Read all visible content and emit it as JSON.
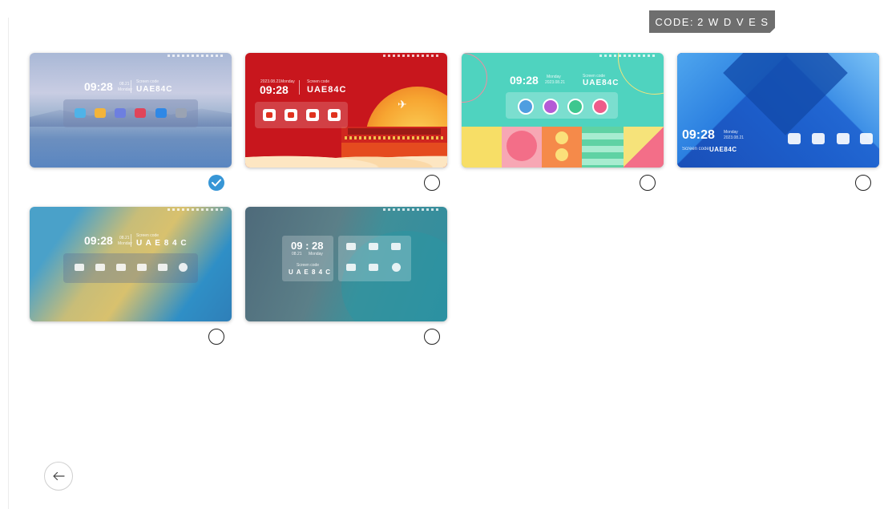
{
  "header": {
    "code_prefix": "CODE:",
    "code_value": "2 W D V E S"
  },
  "themes": [
    {
      "name": "misty-lake",
      "time": "09:28",
      "day": "Monday",
      "date": "08.21",
      "code_label": "Screen code",
      "screen_code": "UAE84C",
      "selected": true
    },
    {
      "name": "red-celebration",
      "time": "09:28",
      "day": "Monday",
      "date": "2023.08.21",
      "code_label": "Screen code",
      "screen_code": "UAE84C",
      "selected": false
    },
    {
      "name": "geometric-pastel",
      "time": "09:28",
      "day": "Monday",
      "date": "2023.08.21",
      "code_label": "Screen code",
      "screen_code": "UAE84C",
      "selected": false
    },
    {
      "name": "blue-geometric",
      "time": "09:28",
      "day": "Monday",
      "date": "2023.08.21",
      "code_label": "Screen code",
      "screen_code": "UAE84C",
      "selected": false
    },
    {
      "name": "gold-blue-gradient",
      "time": "09:28",
      "day": "Monday",
      "date": "08.21",
      "code_label": "Screen code",
      "screen_code": "U A E 8 4 C",
      "selected": false
    },
    {
      "name": "teal-slate",
      "time": "09 : 28",
      "day": "Monday",
      "date": "08.21",
      "code_label": "Screen code",
      "screen_code": "U A E 8 4 C",
      "selected": false
    }
  ],
  "colors": {
    "selected": "#3796d6",
    "badge_bg": "#6e6e6e"
  },
  "icons": {
    "check": "check-icon",
    "back": "arrow-left-icon"
  }
}
